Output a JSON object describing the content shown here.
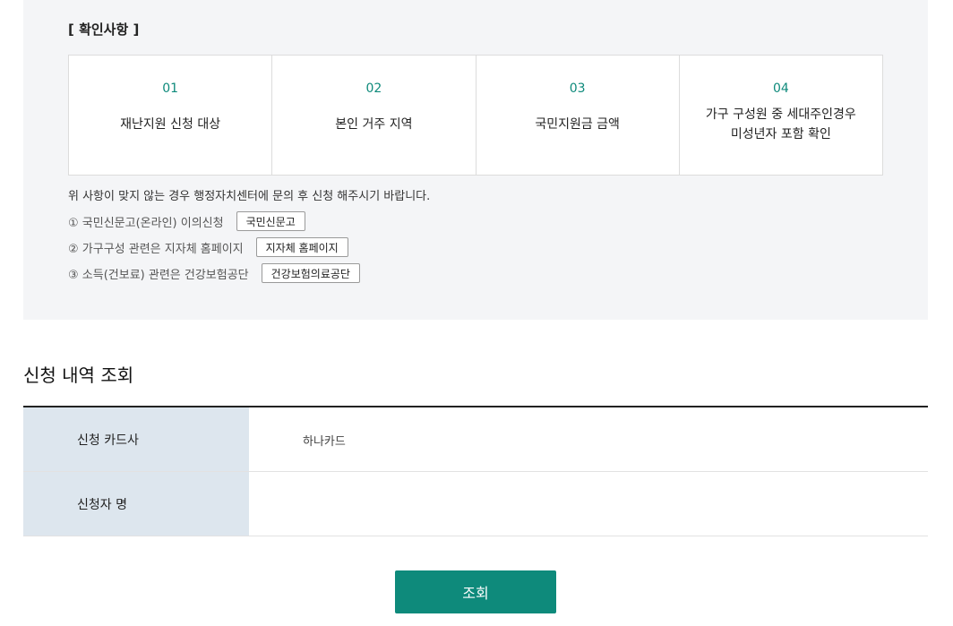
{
  "check": {
    "title": "[ 확인사항 ]",
    "steps": [
      {
        "num": "01",
        "label": "재난지원 신청 대상"
      },
      {
        "num": "02",
        "label": "본인 거주 지역"
      },
      {
        "num": "03",
        "label": "국민지원금 금액"
      },
      {
        "num": "04",
        "label_line1": "가구 구성원 중 세대주인경우",
        "label_line2": "미성년자 포함 확인"
      }
    ],
    "notice": "위 사항이 맞지 않는 경우 행정자치센터에 문의 후 신청 해주시기 바랍니다.",
    "links": [
      {
        "desc": "① 국민신문고(온라인) 이의신청",
        "button": "국민신문고"
      },
      {
        "desc": "② 가구구성 관련은 지자체 홈페이지",
        "button": "지자체 홈페이지"
      },
      {
        "desc": "③ 소득(건보료) 관련은 건강보험공단",
        "button": "건강보험의료공단"
      }
    ]
  },
  "inquiry": {
    "title": "신청 내역 조회",
    "rows": [
      {
        "label": "신청 카드사",
        "value": "하나카드"
      },
      {
        "label": "신청자 명",
        "value": ""
      }
    ],
    "submit_label": "조회"
  },
  "colors": {
    "accent": "#0e8a7b",
    "panel_bg": "#f4f5f7",
    "label_bg": "#dde6ee"
  }
}
